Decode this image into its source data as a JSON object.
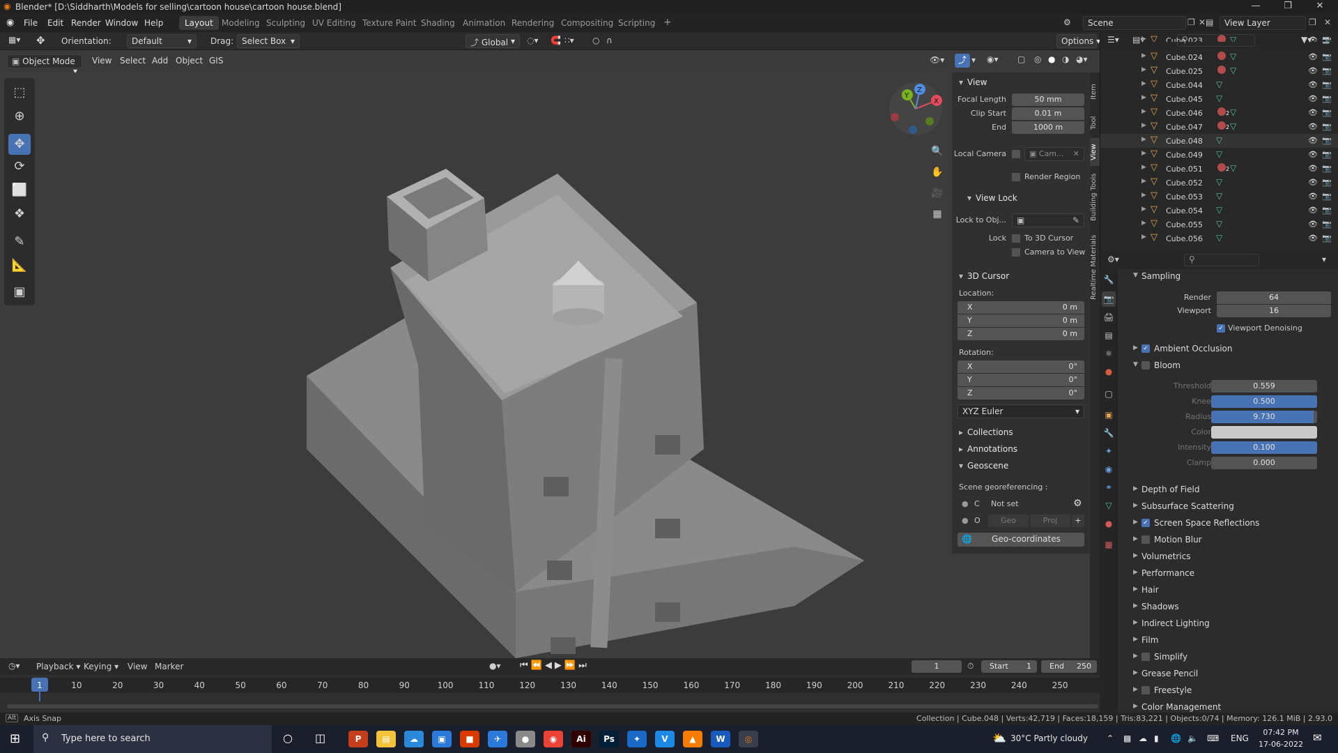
{
  "title_bar": {
    "title": "Blender* [D:\\Siddharth\\Models for selling\\cartoon house\\cartoon house.blend]"
  },
  "menu": {
    "items": [
      "File",
      "Edit",
      "Render",
      "Window",
      "Help"
    ]
  },
  "workspaces": {
    "tabs": [
      "Layout",
      "Modeling",
      "Sculpting",
      "UV Editing",
      "Texture Paint",
      "Shading",
      "Animation",
      "Rendering",
      "Compositing",
      "Scripting"
    ],
    "active": "Layout",
    "add": "+"
  },
  "scene": {
    "name": "Scene",
    "view_layer": "View Layer"
  },
  "tool_header": {
    "orientation_label": "Orientation:",
    "orientation_value": "Default",
    "drag_label": "Drag:",
    "drag_value": "Select Box",
    "transform_orientation": "Global",
    "options": "Options"
  },
  "viewport_header": {
    "mode": "Object Mode",
    "menus": [
      "View",
      "Select",
      "Add",
      "Object",
      "GIS"
    ]
  },
  "gizmo": {
    "x": "X",
    "y": "Y",
    "z": "Z"
  },
  "npanel": {
    "tabs": [
      "Item",
      "Tool",
      "View",
      "Building Tools",
      "Realtime Materials"
    ],
    "active_tab": "View",
    "view": {
      "header": "View",
      "focal_length_label": "Focal Length",
      "focal_length": "50 mm",
      "clip_start_label": "Clip Start",
      "clip_start": "0.01 m",
      "end_label": "End",
      "end": "1000 m",
      "local_camera_label": "Local Camera",
      "local_camera_value": "Cam...",
      "render_region": "Render Region",
      "view_lock_header": "View Lock",
      "lock_to_obj_label": "Lock to Obj...",
      "lock_label": "Lock",
      "to_3d_cursor": "To 3D Cursor",
      "camera_to_view": "Camera to View"
    },
    "cursor": {
      "header": "3D Cursor",
      "location_label": "Location:",
      "location": [
        {
          "axis": "X",
          "value": "0 m"
        },
        {
          "axis": "Y",
          "value": "0 m"
        },
        {
          "axis": "Z",
          "value": "0 m"
        }
      ],
      "rotation_label": "Rotation:",
      "rotation": [
        {
          "axis": "X",
          "value": "0°"
        },
        {
          "axis": "Y",
          "value": "0°"
        },
        {
          "axis": "Z",
          "value": "0°"
        }
      ],
      "rotation_mode": "XYZ Euler"
    },
    "collections": "Collections",
    "annotations": "Annotations",
    "geoscene": {
      "header": "Geoscene",
      "georef_label": "Scene georeferencing :",
      "c_label": "C",
      "c_value": "Not set",
      "o_label": "O",
      "geo_btn": "Geo",
      "proj_btn": "Proj",
      "geo_coords_btn": "Geo-coordinates"
    }
  },
  "outliner": {
    "rows": [
      {
        "name": "Cube.023",
        "mat": true,
        "mat_count": ""
      },
      {
        "name": "Cube.024",
        "mat": true,
        "mat_count": ""
      },
      {
        "name": "Cube.025",
        "mat": true,
        "mat_count": ""
      },
      {
        "name": "Cube.044",
        "mat": false,
        "mat_count": ""
      },
      {
        "name": "Cube.045",
        "mat": false,
        "mat_count": ""
      },
      {
        "name": "Cube.046",
        "mat": true,
        "mat_count": "2"
      },
      {
        "name": "Cube.047",
        "mat": true,
        "mat_count": "2"
      },
      {
        "name": "Cube.048",
        "mat": false,
        "mat_count": ""
      },
      {
        "name": "Cube.049",
        "mat": false,
        "mat_count": ""
      },
      {
        "name": "Cube.051",
        "mat": true,
        "mat_count": "2"
      },
      {
        "name": "Cube.052",
        "mat": false,
        "mat_count": ""
      },
      {
        "name": "Cube.053",
        "mat": false,
        "mat_count": ""
      },
      {
        "name": "Cube.054",
        "mat": false,
        "mat_count": ""
      },
      {
        "name": "Cube.055",
        "mat": false,
        "mat_count": ""
      },
      {
        "name": "Cube.056",
        "mat": false,
        "mat_count": ""
      }
    ]
  },
  "properties": {
    "sampling": {
      "header": "Sampling",
      "render_label": "Render",
      "render": "64",
      "viewport_label": "Viewport",
      "viewport": "16",
      "denoise": "Viewport Denoising"
    },
    "ambient_occlusion": "Ambient Occlusion",
    "bloom": {
      "header": "Bloom",
      "rows": [
        {
          "label": "Threshold",
          "value": "0.559",
          "fill": 0.0
        },
        {
          "label": "Knee",
          "value": "0.500",
          "fill": 1.0
        },
        {
          "label": "Radius",
          "value": "9.730",
          "fill": 0.97
        },
        {
          "label": "Color",
          "value": "",
          "fill": 0.0
        },
        {
          "label": "Intensity",
          "value": "0.100",
          "fill": 1.0
        },
        {
          "label": "Clamp",
          "value": "0.000",
          "fill": 0.0
        }
      ]
    },
    "sections": [
      {
        "label": "Depth of Field",
        "checkbox": "none"
      },
      {
        "label": "Subsurface Scattering",
        "checkbox": "none"
      },
      {
        "label": "Screen Space Reflections",
        "checkbox": "on"
      },
      {
        "label": "Motion Blur",
        "checkbox": "off"
      },
      {
        "label": "Volumetrics",
        "checkbox": "none"
      },
      {
        "label": "Performance",
        "checkbox": "none"
      },
      {
        "label": "Hair",
        "checkbox": "none"
      },
      {
        "label": "Shadows",
        "checkbox": "none"
      },
      {
        "label": "Indirect Lighting",
        "checkbox": "none"
      },
      {
        "label": "Film",
        "checkbox": "none"
      },
      {
        "label": "Simplify",
        "checkbox": "off"
      },
      {
        "label": "Grease Pencil",
        "checkbox": "none"
      },
      {
        "label": "Freestyle",
        "checkbox": "off"
      },
      {
        "label": "Color Management",
        "checkbox": "none"
      }
    ]
  },
  "timeline": {
    "menus": [
      "Playback",
      "Keying",
      "View",
      "Marker"
    ],
    "current_frame": "1",
    "start_label": "Start",
    "start": "1",
    "end_label": "End",
    "end": "250",
    "ruler": [
      "1",
      "10",
      "20",
      "30",
      "40",
      "50",
      "60",
      "70",
      "80",
      "90",
      "100",
      "110",
      "120",
      "130",
      "140",
      "150",
      "160",
      "170",
      "180",
      "190",
      "200",
      "210",
      "220",
      "230",
      "240",
      "250"
    ]
  },
  "status": {
    "left": "Axis Snap",
    "right": "Collection | Cube.048 | Verts:42,719 | Faces:18,159 | Tris:83,221 | Objects:0/74 | Memory: 126.1 MiB | 2.93.0"
  },
  "taskbar": {
    "search_placeholder": "Type here to search",
    "weather": "30°C  Partly cloudy",
    "lang": "ENG",
    "time": "07:42 PM",
    "date": "17-06-2022",
    "apps": [
      "P",
      "▤",
      "☁",
      "▣",
      "■",
      "✈",
      "●",
      "◉",
      "Ai",
      "Ps",
      "✦",
      "V",
      "▲",
      "W",
      "◎"
    ]
  },
  "colors": {
    "accent": "#4772b3",
    "mesh_icon": "#e0a24e",
    "modifier_icon": "#4ec29b"
  }
}
